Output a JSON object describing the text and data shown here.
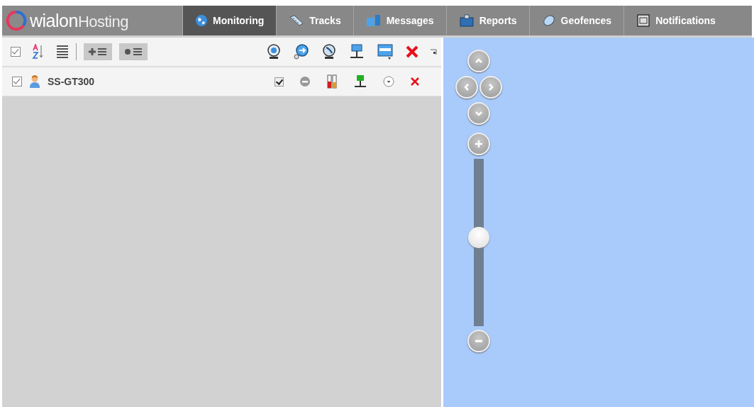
{
  "logo": {
    "brand": "wialon",
    "product": "Hosting"
  },
  "tabs": [
    {
      "label": "Monitoring",
      "selected": true
    },
    {
      "label": "Tracks",
      "selected": false
    },
    {
      "label": "Messages",
      "selected": false
    },
    {
      "label": "Reports",
      "selected": false
    },
    {
      "label": "Geofences",
      "selected": false
    },
    {
      "label": "Notifications",
      "selected": false
    }
  ],
  "toolbar": {
    "select_all_checked": true
  },
  "units": [
    {
      "name": "SS-GT300",
      "checked": true,
      "visible": true
    }
  ],
  "map": {
    "zoom": {
      "level": 0.53
    }
  }
}
